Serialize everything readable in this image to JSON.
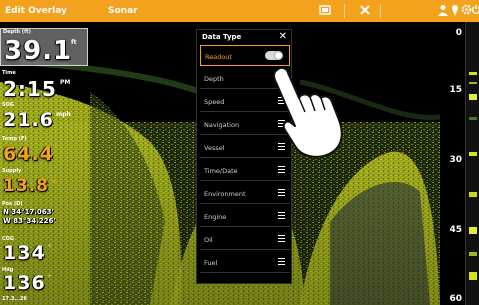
{
  "topbar": {
    "title": "Edit Overlay",
    "view": "Sonar",
    "icons": [
      "screen-icon",
      "close-icon",
      "person-icon",
      "pin-icon",
      "gear-icon",
      "power-icon"
    ]
  },
  "readouts": {
    "depth": {
      "label": "Depth (ft)",
      "value": "39.1",
      "unit": "ft"
    },
    "time": {
      "label": "Time",
      "value": "2:15",
      "unit": "PM"
    },
    "sog": {
      "label": "SOG",
      "value": "21.6",
      "unit": "mph"
    },
    "temp": {
      "label": "Temp (F)",
      "value": "64.4",
      "unit": "°"
    },
    "supply": {
      "label": "Supply",
      "value": "13.8",
      "unit": "v"
    },
    "position": {
      "label": "Pos (D)",
      "lat": "N 34°17.063'",
      "lon": "W 83°34.226'"
    },
    "cog": {
      "label": "COG",
      "value": "134",
      "unit": "°"
    },
    "hdg": {
      "label": "Hdg",
      "value": "136",
      "unit": "°"
    },
    "bottom": "17.3...26"
  },
  "scale": [
    "0",
    "15",
    "30",
    "45",
    "60"
  ],
  "menu": {
    "title": "Data Type",
    "close": "✕",
    "items": [
      {
        "label": "Readout",
        "selected": true
      },
      {
        "label": "Depth"
      },
      {
        "label": "Speed"
      },
      {
        "label": "Navigation"
      },
      {
        "label": "Vessel"
      },
      {
        "label": "Time/Date"
      },
      {
        "label": "Environment"
      },
      {
        "label": "Engine"
      },
      {
        "label": "Oil"
      },
      {
        "label": "Fuel"
      }
    ]
  },
  "colors": {
    "accent": "#f3a21d",
    "sonar": "#d8e21b"
  }
}
